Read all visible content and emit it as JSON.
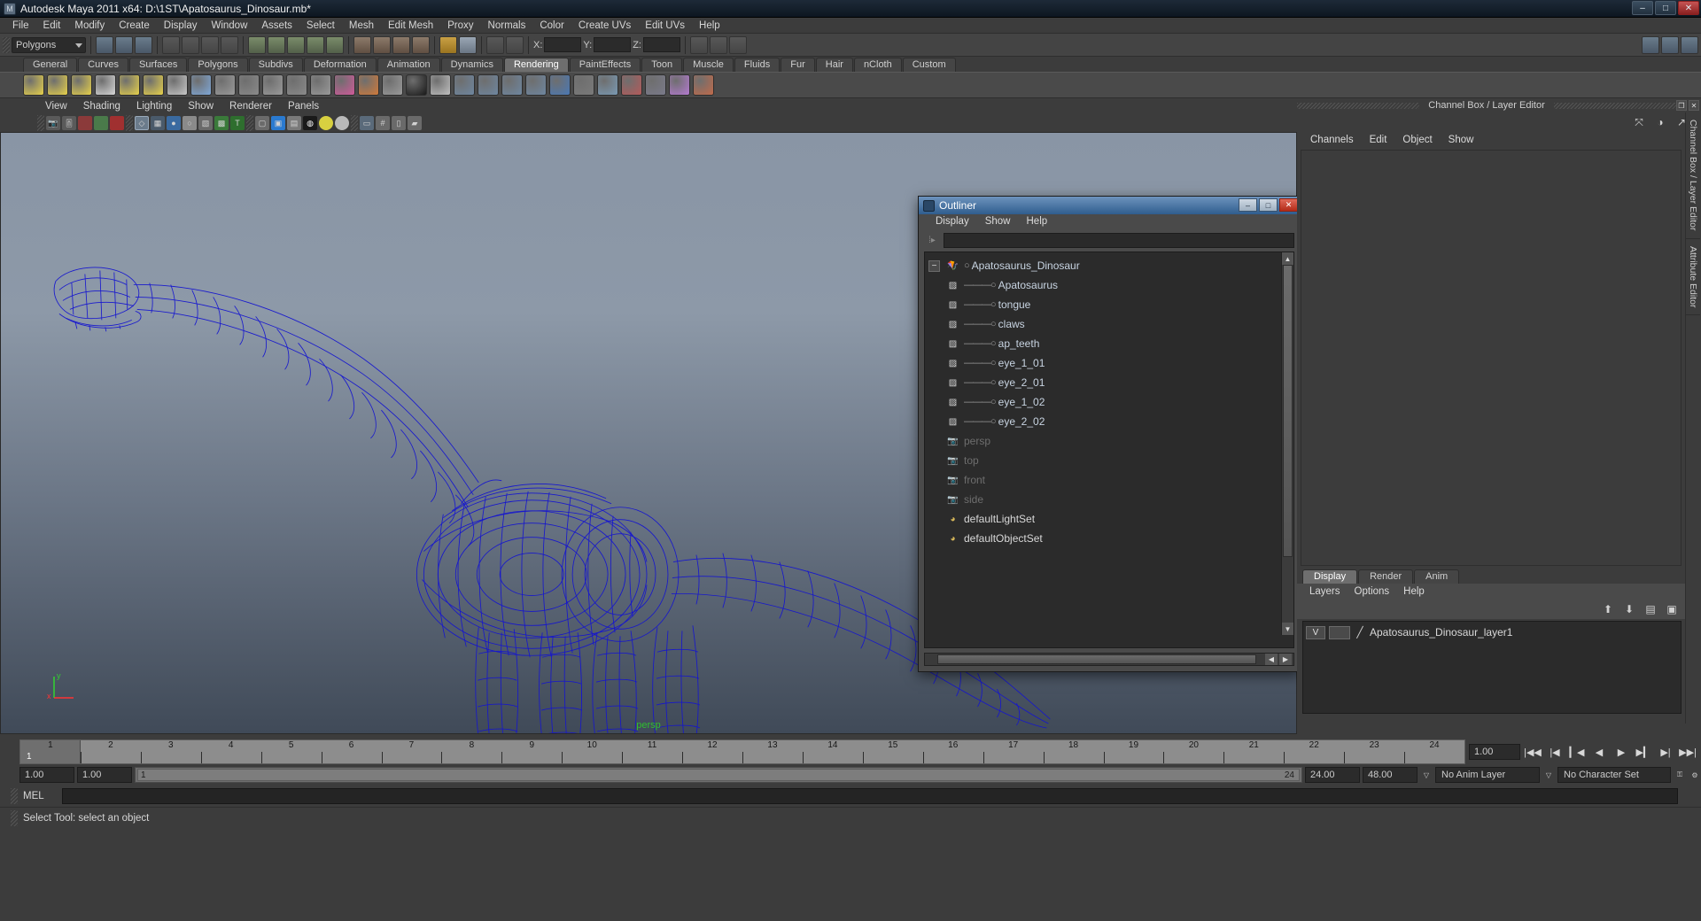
{
  "window": {
    "title": "Autodesk Maya 2011 x64: D:\\1ST\\Apatosaurus_Dinosaur.mb*",
    "app_icon": "maya-icon",
    "minimize": "–",
    "maximize": "□",
    "close": "✕"
  },
  "menubar": {
    "items": [
      "File",
      "Edit",
      "Modify",
      "Create",
      "Display",
      "Window",
      "Assets",
      "Select",
      "Mesh",
      "Edit Mesh",
      "Proxy",
      "Normals",
      "Color",
      "Create UVs",
      "Edit UVs",
      "Help"
    ]
  },
  "statusline": {
    "mode_selector": "Polygons",
    "coord_labels": [
      "X:",
      "Y:",
      "Z:"
    ],
    "coord_values": [
      "",
      "",
      ""
    ]
  },
  "shelf": {
    "tabs": [
      "General",
      "Curves",
      "Surfaces",
      "Polygons",
      "Subdivs",
      "Deformation",
      "Animation",
      "Dynamics",
      "Rendering",
      "PaintEffects",
      "Toon",
      "Muscle",
      "Fluids",
      "Fur",
      "Hair",
      "nCloth",
      "Custom"
    ],
    "active_tab": "Rendering"
  },
  "viewport": {
    "panel_menu": [
      "View",
      "Shading",
      "Lighting",
      "Show",
      "Renderer",
      "Panels"
    ],
    "camera_label": "persp",
    "axis": {
      "y": "y",
      "x": "x"
    },
    "background_top": "#8995a5",
    "background_bottom": "#404a58",
    "wireframe_color": "#1414d0"
  },
  "outliner": {
    "title": "Outliner",
    "menu": [
      "Display",
      "Show",
      "Help"
    ],
    "search_value": "",
    "search_placeholder": "",
    "items": [
      {
        "label": "Apatosaurus_Dinosaur",
        "icon": "group-transform-icon",
        "level": 0,
        "dim": false,
        "expander": "−"
      },
      {
        "label": "Apatosaurus",
        "icon": "mesh-icon",
        "level": 1,
        "dim": false
      },
      {
        "label": "tongue",
        "icon": "mesh-icon",
        "level": 1,
        "dim": false
      },
      {
        "label": "claws",
        "icon": "mesh-icon",
        "level": 1,
        "dim": false
      },
      {
        "label": "ap_teeth",
        "icon": "mesh-icon",
        "level": 1,
        "dim": false
      },
      {
        "label": "eye_1_01",
        "icon": "mesh-icon",
        "level": 1,
        "dim": false
      },
      {
        "label": "eye_2_01",
        "icon": "mesh-icon",
        "level": 1,
        "dim": false
      },
      {
        "label": "eye_1_02",
        "icon": "mesh-icon",
        "level": 1,
        "dim": false
      },
      {
        "label": "eye_2_02",
        "icon": "mesh-icon",
        "level": 1,
        "dim": false
      },
      {
        "label": "persp",
        "icon": "camera-icon",
        "level": 0,
        "dim": true
      },
      {
        "label": "top",
        "icon": "camera-icon",
        "level": 0,
        "dim": true
      },
      {
        "label": "front",
        "icon": "camera-icon",
        "level": 0,
        "dim": true
      },
      {
        "label": "side",
        "icon": "camera-icon",
        "level": 0,
        "dim": true
      },
      {
        "label": "defaultLightSet",
        "icon": "set-icon",
        "level": 0,
        "dim": false
      },
      {
        "label": "defaultObjectSet",
        "icon": "set-icon",
        "level": 0,
        "dim": false
      }
    ]
  },
  "channelbox": {
    "dock_title": "Channel Box / Layer Editor",
    "menu": [
      "Channels",
      "Edit",
      "Object",
      "Show"
    ],
    "side_tabs": [
      "Channel Box / Layer Editor",
      "Attribute Editor"
    ],
    "maximize": "❐",
    "close": "✕"
  },
  "layereditor": {
    "tabs": [
      "Display",
      "Render",
      "Anim"
    ],
    "active_tab": "Display",
    "menu": [
      "Layers",
      "Options",
      "Help"
    ],
    "layers": [
      {
        "visibility": "V",
        "shading": "",
        "name": "Apatosaurus_Dinosaur_layer1"
      }
    ]
  },
  "timeline": {
    "frames": [
      "1",
      "2",
      "3",
      "4",
      "5",
      "6",
      "7",
      "8",
      "9",
      "10",
      "11",
      "12",
      "13",
      "14",
      "15",
      "16",
      "17",
      "18",
      "19",
      "20",
      "21",
      "22",
      "23",
      "24"
    ],
    "current_frame": "1",
    "current_time_field": "1.00",
    "playback_buttons": [
      "go-to-start",
      "step-back-key",
      "step-back-frame",
      "play-backwards",
      "play-forwards",
      "step-forward-frame",
      "step-forward-key",
      "go-to-end"
    ]
  },
  "rangebar": {
    "anim_start": "1.00",
    "range_start": "1.00",
    "slider_left_label": "1",
    "slider_right_label": "24",
    "range_end": "24.00",
    "anim_end": "48.00",
    "anim_layer": "No Anim Layer",
    "character_set": "No Character Set"
  },
  "melbar": {
    "label": "MEL",
    "value": "",
    "placeholder": ""
  },
  "statusbar": {
    "message": "Select Tool: select an object"
  }
}
